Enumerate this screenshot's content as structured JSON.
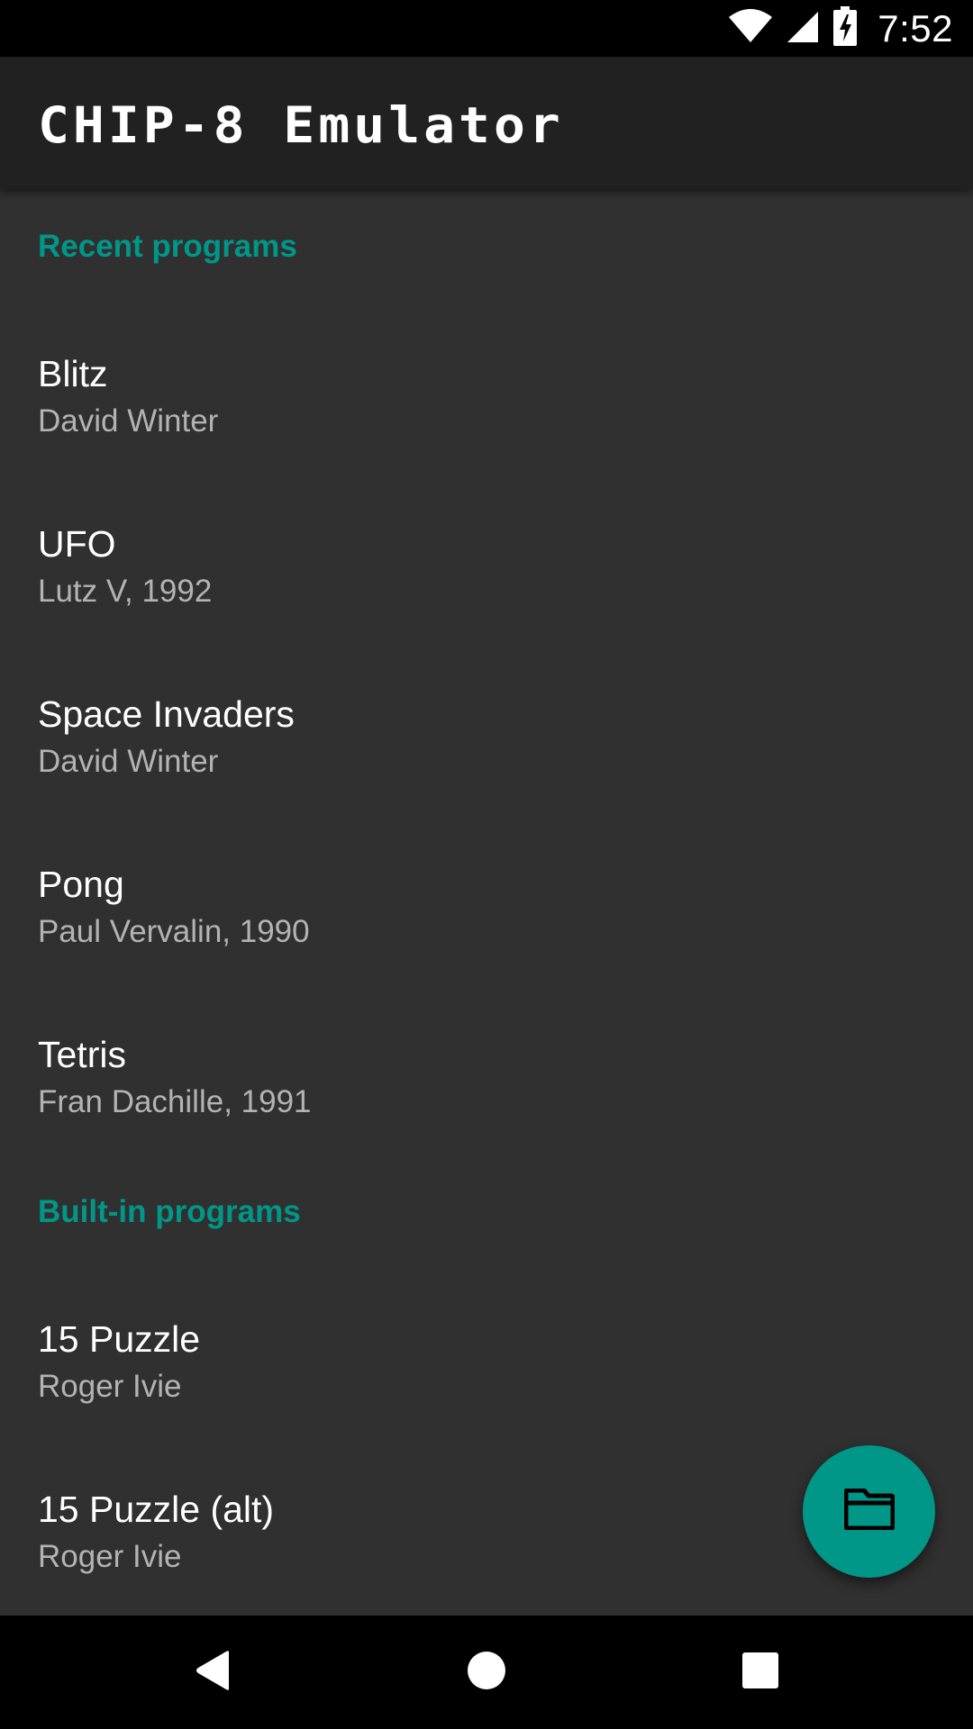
{
  "status_bar": {
    "time": "7:52",
    "icons": [
      "wifi-icon",
      "cell-signal-icon",
      "battery-charging-icon"
    ]
  },
  "app_bar": {
    "title": "CHIP-8 Emulator"
  },
  "sections": {
    "recent": {
      "header": "Recent programs",
      "items": [
        {
          "title": "Blitz",
          "subtitle": "David Winter"
        },
        {
          "title": "UFO",
          "subtitle": "Lutz V, 1992"
        },
        {
          "title": "Space Invaders",
          "subtitle": "David Winter"
        },
        {
          "title": "Pong",
          "subtitle": "Paul Vervalin, 1990"
        },
        {
          "title": "Tetris",
          "subtitle": "Fran Dachille, 1991"
        }
      ]
    },
    "builtin": {
      "header": "Built-in programs",
      "items": [
        {
          "title": "15 Puzzle",
          "subtitle": "Roger Ivie"
        },
        {
          "title": "15 Puzzle (alt)",
          "subtitle": "Roger Ivie"
        }
      ]
    }
  },
  "fab": {
    "icon": "folder-icon",
    "color": "#009688"
  },
  "nav_bar": {
    "icons": [
      "back-icon",
      "home-icon",
      "recents-icon"
    ]
  },
  "colors": {
    "accent": "#009688",
    "background": "#303030",
    "app_bar": "#212121",
    "subtitle": "#b3b3b3"
  }
}
